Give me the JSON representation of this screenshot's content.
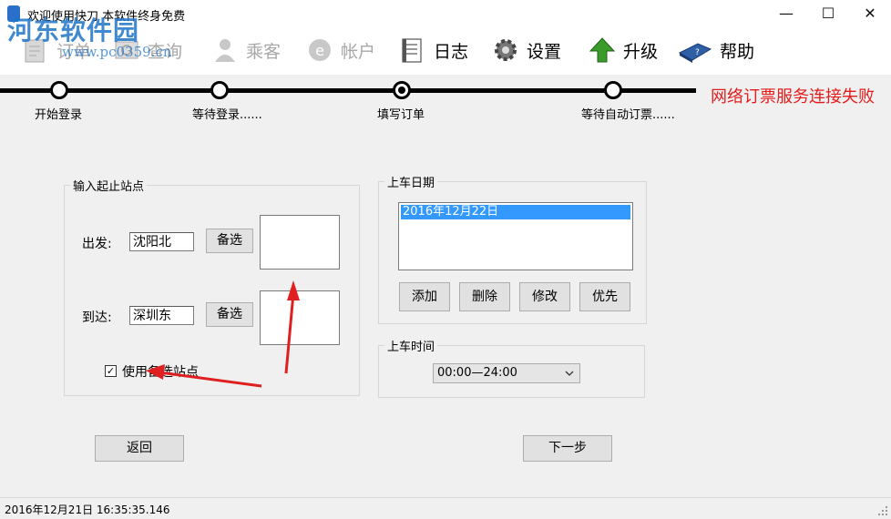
{
  "window": {
    "title": "欢迎使用快刀 本软件终身免费",
    "minimize_glyph": "—",
    "maximize_glyph": "☐",
    "close_glyph": "✕"
  },
  "watermark": {
    "main": "河东软件园",
    "sub": "www.pc0359.cn"
  },
  "toolbar": {
    "items": [
      {
        "label": "订单",
        "icon": "order-icon",
        "enabled": false
      },
      {
        "label": "查询",
        "icon": "query-icon",
        "enabled": false
      },
      {
        "label": "乘客",
        "icon": "passenger-icon",
        "enabled": false
      },
      {
        "label": "帐户",
        "icon": "account-icon",
        "enabled": false
      },
      {
        "label": "日志",
        "icon": "log-icon",
        "enabled": true
      },
      {
        "label": "设置",
        "icon": "gear-icon",
        "enabled": true
      },
      {
        "label": "升级",
        "icon": "upgrade-arrow-icon",
        "enabled": true
      },
      {
        "label": "帮助",
        "icon": "help-book-icon",
        "enabled": true
      }
    ]
  },
  "steps": [
    {
      "label": "开始登录"
    },
    {
      "label": "等待登录......"
    },
    {
      "label": "填写订单",
      "current": true
    },
    {
      "label": "等待自动订票......"
    }
  ],
  "connection_status": "网络订票服务连接失败",
  "stations": {
    "group_title": "输入起止站点",
    "from_label": "出发:",
    "from_value": "沈阳北",
    "to_label": "到达:",
    "to_value": "深圳东",
    "alt_button": "备选",
    "use_alt_label": "使用备选站点",
    "use_alt_checked": true,
    "check_glyph": "✓"
  },
  "date": {
    "group_title": "上车日期",
    "dates": [
      "2016年12月22日"
    ],
    "buttons": {
      "add": "添加",
      "delete": "删除",
      "edit": "修改",
      "priority": "优先"
    }
  },
  "time": {
    "group_title": "上车时间",
    "selected": "00:00—24:00"
  },
  "nav": {
    "back": "返回",
    "next": "下一步"
  },
  "statusbar": {
    "timestamp": "2016年12月21日 16:35:35.146"
  },
  "colors": {
    "error_text": "#e31b1b",
    "selection": "#3399ff",
    "watermark": "#1f75c9"
  }
}
